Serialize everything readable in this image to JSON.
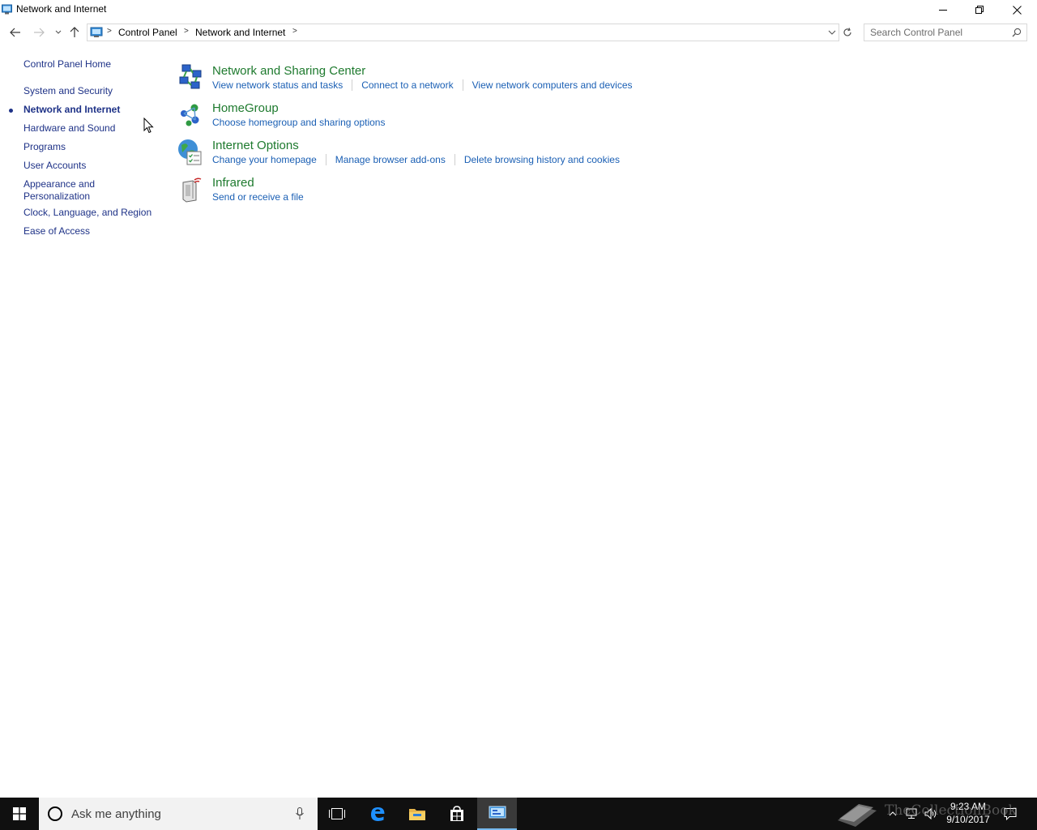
{
  "window": {
    "title": "Network and Internet"
  },
  "addressbar": {
    "crumbs": [
      "Control Panel",
      "Network and Internet"
    ]
  },
  "search": {
    "placeholder": "Search Control Panel"
  },
  "sidebar": {
    "items": [
      {
        "label": "Control Panel Home"
      },
      {
        "label": "System and Security"
      },
      {
        "label": "Network and Internet",
        "current": true
      },
      {
        "label": "Hardware and Sound"
      },
      {
        "label": "Programs"
      },
      {
        "label": "User Accounts"
      },
      {
        "label": "Appearance and"
      },
      {
        "label": "Personalization"
      },
      {
        "label": "Clock, Language, and Region"
      },
      {
        "label": "Ease of Access"
      }
    ]
  },
  "categories": [
    {
      "title": "Network and Sharing Center",
      "icon": "network-sharing-icon",
      "links": [
        "View network status and tasks",
        "Connect to a network",
        "View network computers and devices"
      ]
    },
    {
      "title": "HomeGroup",
      "icon": "homegroup-icon",
      "links": [
        "Choose homegroup and sharing options"
      ]
    },
    {
      "title": "Internet Options",
      "icon": "internet-options-icon",
      "links": [
        "Change your homepage",
        "Manage browser add-ons",
        "Delete browsing history and cookies"
      ]
    },
    {
      "title": "Infrared",
      "icon": "infrared-icon",
      "links": [
        "Send or receive a file"
      ]
    }
  ],
  "taskbar": {
    "cortana_placeholder": "Ask me anything",
    "time": "9:23 AM",
    "date": "9/10/2017",
    "watermark": "TheCollectionBook",
    "accent": "#76b9ed"
  },
  "colors": {
    "link": "#1a5fb4",
    "sidebar_link": "#1e3287",
    "category_title": "#1e7a2e"
  }
}
